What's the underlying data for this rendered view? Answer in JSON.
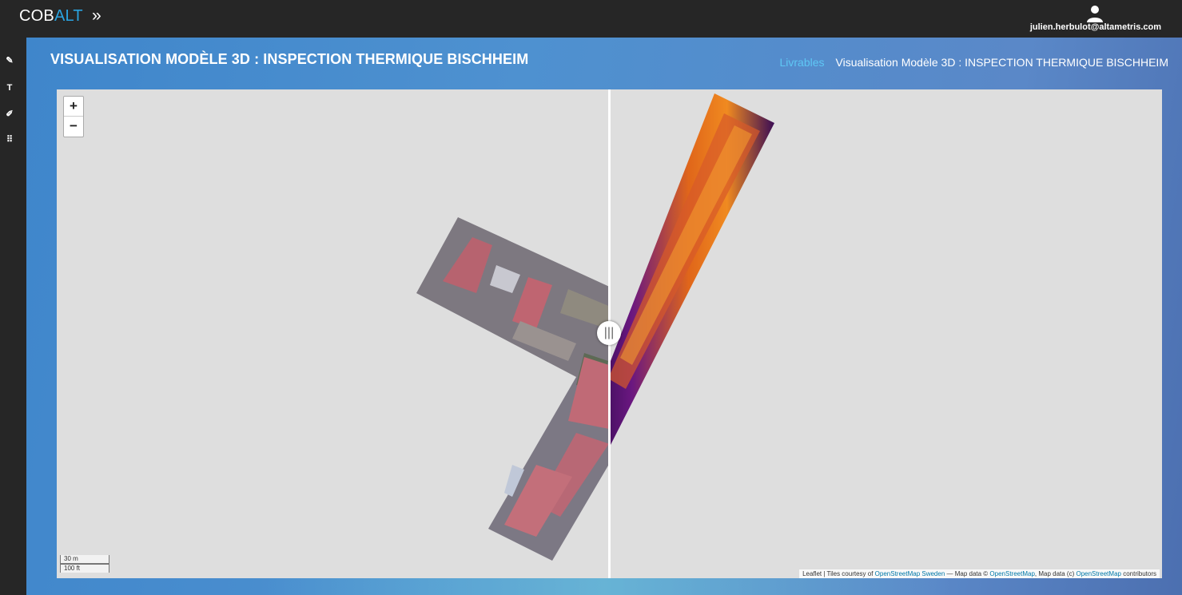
{
  "app": {
    "brand_part1": "COB",
    "brand_part2": "ALT",
    "expand_icon_glyph": "»",
    "brand_color": "#2aa3e0"
  },
  "user": {
    "email": "julien.herbulot@altametris.com",
    "icon": "user-icon"
  },
  "sidebar": {
    "items": [
      {
        "name": "pencil-icon",
        "glyph": "✎"
      },
      {
        "name": "text-icon",
        "glyph": "T"
      },
      {
        "name": "edit-icon",
        "glyph": "✐"
      },
      {
        "name": "grid-icon",
        "glyph": "⠿"
      }
    ]
  },
  "header": {
    "title": "VISUALISATION MODÈLE 3D : INSPECTION THERMIQUE BISCHHEIM",
    "breadcrumb_link": "Livrables",
    "breadcrumb_current": "Visualisation Modèle 3D : INSPECTION THERMIQUE BISCHHEIM"
  },
  "map": {
    "zoom_in": "+",
    "zoom_out": "−",
    "scale_metric": "30 m",
    "scale_imperial": "100 ft",
    "attribution": {
      "prefix": "Leaflet | Tiles courtesy of ",
      "link1": "OpenStreetMap Sweden",
      "mid1": " — Map data © ",
      "link2": "OpenStreetMap",
      "mid2": ", Map data (c) ",
      "link3": "OpenStreetMap",
      "suffix": " contributors"
    },
    "divider_handle_glyph": "|||"
  }
}
